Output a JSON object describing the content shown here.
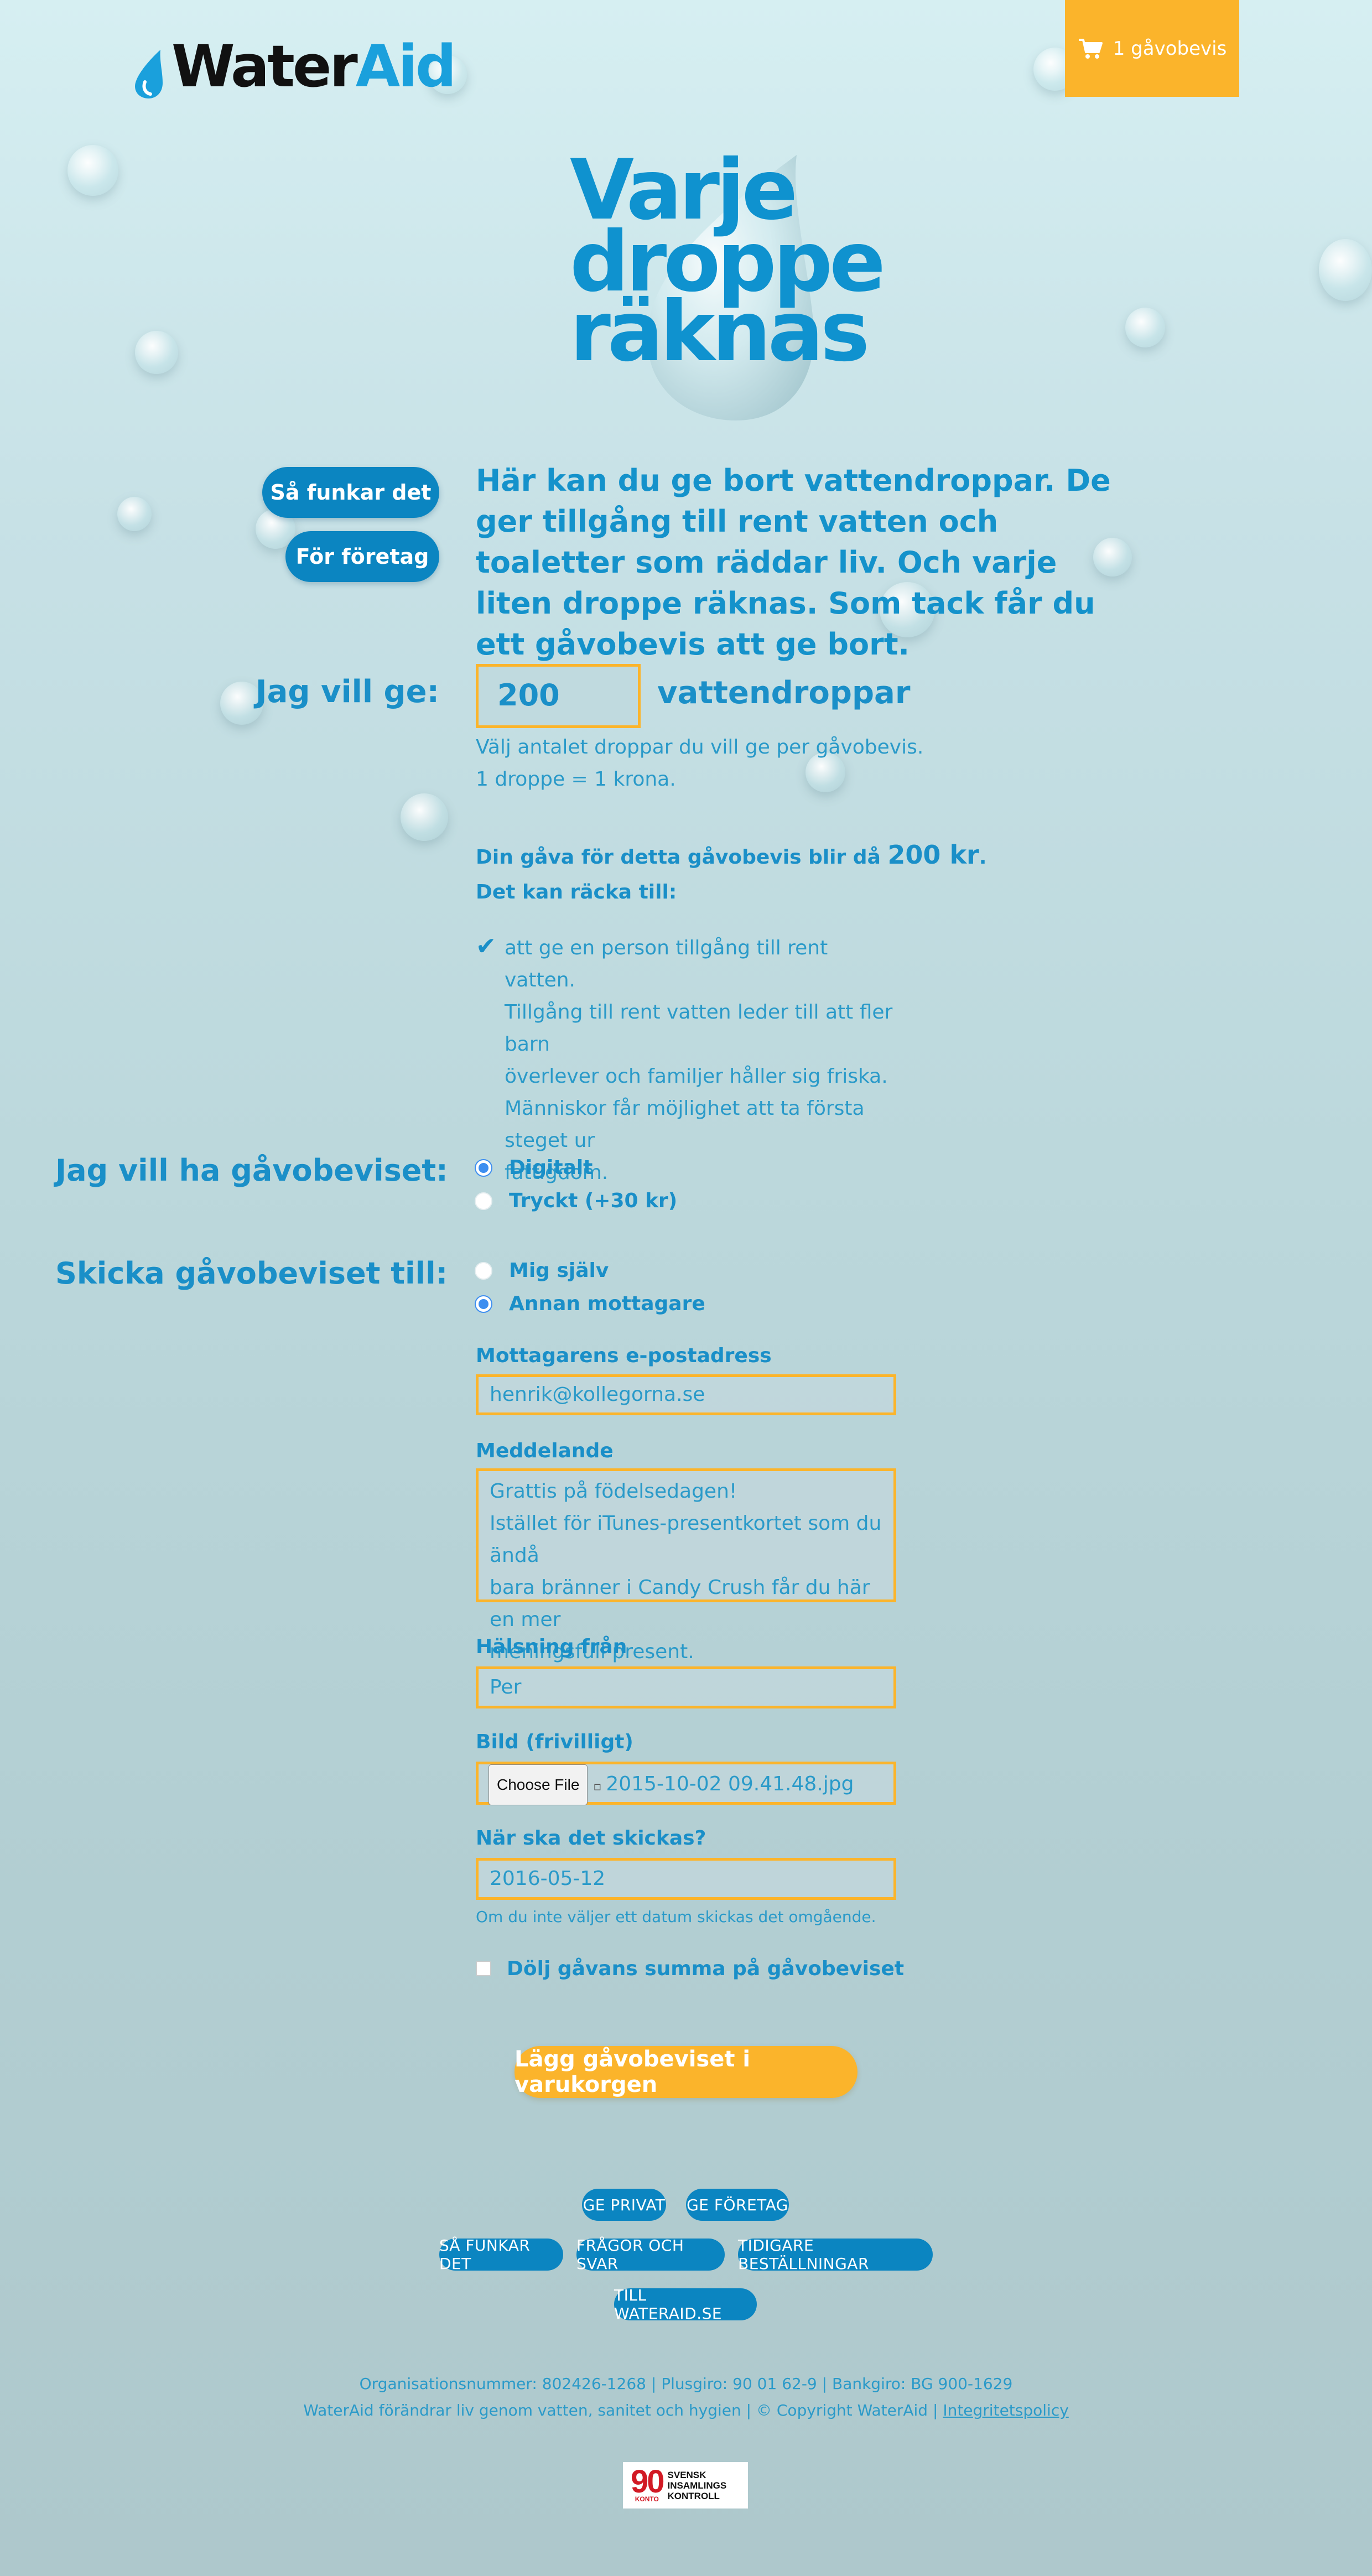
{
  "header": {
    "logo_water": "Water",
    "logo_aid": "Aid",
    "cart_label": "1 gåvobevis"
  },
  "hero": {
    "lines": [
      "Varje",
      "droppe",
      "räknas"
    ]
  },
  "side_nav": {
    "how_it_works": "Så funkar det",
    "for_companies": "För företag"
  },
  "intro": "Här kan du ge bort vattendroppar. De ger tillgång till rent vatten och toaletter som räddar liv. Och varje liten droppe räknas. Som tack får du ett gåvobevis att ge bort.",
  "give": {
    "label": "Jag vill ge:",
    "amount": "200",
    "unit": "vattendroppar",
    "hint_1": "Välj antalet droppar du vill ge per gåvobevis.",
    "hint_2": "1 droppe = 1 krona.",
    "summary_prefix": "Din gåva för detta gåvobevis blir då ",
    "summary_amount": "200 kr",
    "summary_suffix": ".",
    "can_cover": "Det kan räcka till:",
    "benefit_title": "att ge en person tillgång till rent vatten.",
    "benefit_lines": [
      "att ge en person tillgång till rent vatten.",
      "Tillgång till rent vatten leder till att fler barn",
      "överlever och familjer håller sig friska.",
      "Människor får möjlighet att ta första steget ur",
      "fattigdom."
    ]
  },
  "format": {
    "label": "Jag vill ha gåvobeviset:",
    "options": [
      {
        "label": "Digitalt",
        "selected": true
      },
      {
        "label": "Tryckt (+30 kr)",
        "selected": false
      }
    ]
  },
  "send_to": {
    "label": "Skicka gåvobeviset till:",
    "options": [
      {
        "label": "Mig själv",
        "selected": false
      },
      {
        "label": "Annan mottagare",
        "selected": true
      }
    ]
  },
  "form": {
    "email_label": "Mottagarens e-postadress",
    "email_value": "henrik@kollegorna.se",
    "message_label": "Meddelande",
    "message_lines": [
      "Grattis på födelsedagen!",
      "Istället för iTunes-presentkortet som du ändå",
      "bara bränner i Candy Crush får du här en mer",
      "meningsfull present."
    ],
    "greeting_label": "Hälsning från",
    "greeting_value": "Per",
    "image_label": "Bild (frivilligt)",
    "file_button": "Choose File",
    "file_name": "2015-10-02 09.41.48.jpg",
    "date_label": "När ska det skickas?",
    "date_value": "2016-05-12",
    "date_note": "Om du inte väljer ett datum skickas det omgående.",
    "hide_amount_label": "Dölj gåvans summa på gåvobeviset",
    "hide_amount_checked": false,
    "submit_label": "Lägg gåvobeviset i varukorgen"
  },
  "footer": {
    "nav": {
      "row1": [
        "GE PRIVAT",
        "GE FÖRETAG"
      ],
      "row2": [
        "SÅ FUNKAR DET",
        "FRÅGOR OCH SVAR",
        "TIDIGARE BESTÄLLNINGAR"
      ],
      "row3": [
        "TILL WATERAID.SE"
      ]
    },
    "org_line": "Organisationsnummer: 802426-1268 | Plusgiro: 90 01 62-9 | Bankgiro: BG 900-1629",
    "tagline": "WaterAid förändrar liv genom vatten, sanitet och hygien | © Copyright WaterAid | ",
    "privacy_link": "Integritetspolicy",
    "badge_number": "90",
    "badge_konto": "KONTO",
    "badge_lines": [
      "SVENSK",
      "INSAMLINGS",
      "KONTROLL"
    ]
  },
  "colors": {
    "accent_yellow": "#fbb42b",
    "brand_blue": "#0b85c1",
    "text_blue": "#1a8fc8"
  }
}
